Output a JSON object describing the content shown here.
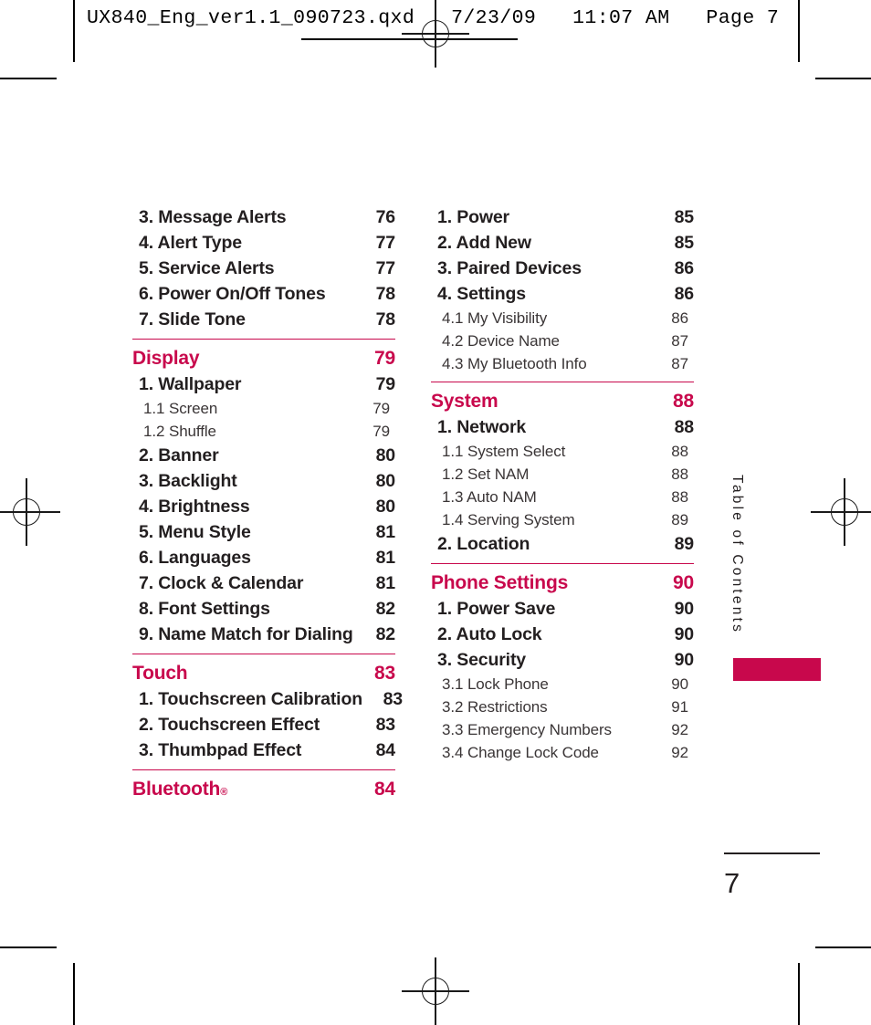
{
  "prepress": {
    "slug": "UX840_Eng_ver1.1_090723.qxd   7/23/09   11:07 AM   Page 7"
  },
  "side_running_head": "Table of Contents",
  "folio": "7",
  "colors": {
    "accent": "#c8084c",
    "text": "#231f20",
    "subtext": "#3a3536"
  },
  "toc": {
    "left_column": [
      {
        "type": "item1",
        "label": "3. Message Alerts",
        "page": "76"
      },
      {
        "type": "item1",
        "label": "4. Alert Type",
        "page": "77"
      },
      {
        "type": "item1",
        "label": "5. Service Alerts",
        "page": "77"
      },
      {
        "type": "item1",
        "label": "6. Power On/Off Tones",
        "page": "78"
      },
      {
        "type": "item1",
        "label": "7. Slide Tone",
        "page": "78"
      },
      {
        "type": "section",
        "label": "Display",
        "page": "79"
      },
      {
        "type": "item1",
        "label": "1. Wallpaper",
        "page": "79"
      },
      {
        "type": "item2",
        "label": "1.1 Screen",
        "page": "79"
      },
      {
        "type": "item2",
        "label": "1.2 Shuffle",
        "page": "79"
      },
      {
        "type": "item1",
        "label": "2. Banner",
        "page": "80"
      },
      {
        "type": "item1",
        "label": "3. Backlight",
        "page": "80"
      },
      {
        "type": "item1",
        "label": "4. Brightness",
        "page": "80"
      },
      {
        "type": "item1",
        "label": "5. Menu Style",
        "page": "81"
      },
      {
        "type": "item1",
        "label": "6. Languages",
        "page": "81"
      },
      {
        "type": "item1",
        "label": "7. Clock & Calendar",
        "page": "81"
      },
      {
        "type": "item1",
        "label": "8. Font Settings",
        "page": "82"
      },
      {
        "type": "item1",
        "label": "9.  Name Match for Dialing",
        "page": "82"
      },
      {
        "type": "section",
        "label": "Touch",
        "page": "83"
      },
      {
        "type": "item1",
        "label": "1. Touchscreen Calibration",
        "page": "83"
      },
      {
        "type": "item1",
        "label": "2. Touchscreen Effect",
        "page": "83"
      },
      {
        "type": "item1",
        "label": "3. Thumbpad Effect",
        "page": "84"
      },
      {
        "type": "section",
        "label": "Bluetooth",
        "label_sup": "®",
        "page": "84"
      }
    ],
    "right_column": [
      {
        "type": "item1",
        "label": "1. Power",
        "page": "85"
      },
      {
        "type": "item1",
        "label": "2. Add New",
        "page": "85"
      },
      {
        "type": "item1",
        "label": "3. Paired Devices",
        "page": "86"
      },
      {
        "type": "item1",
        "label": "4. Settings",
        "page": "86"
      },
      {
        "type": "item2",
        "label": "4.1 My Visibility",
        "page": "86"
      },
      {
        "type": "item2",
        "label": "4.2 Device Name",
        "page": "87"
      },
      {
        "type": "item2",
        "label": "4.3 My Bluetooth Info",
        "page": "87"
      },
      {
        "type": "section",
        "label": "System",
        "page": "88"
      },
      {
        "type": "item1",
        "label": "1. Network",
        "page": "88"
      },
      {
        "type": "item2",
        "label": "1.1 System Select",
        "page": "88"
      },
      {
        "type": "item2",
        "label": "1.2 Set NAM",
        "page": "88"
      },
      {
        "type": "item2",
        "label": "1.3 Auto NAM",
        "page": "88"
      },
      {
        "type": "item2",
        "label": "1.4 Serving System",
        "page": "89"
      },
      {
        "type": "item1",
        "label": "2. Location",
        "page": "89"
      },
      {
        "type": "section",
        "label": "Phone Settings",
        "page": "90"
      },
      {
        "type": "item1",
        "label": "1. Power Save",
        "page": "90"
      },
      {
        "type": "item1",
        "label": "2. Auto Lock",
        "page": "90"
      },
      {
        "type": "item1",
        "label": "3. Security",
        "page": "90"
      },
      {
        "type": "item2",
        "label": "3.1 Lock Phone",
        "page": "90"
      },
      {
        "type": "item2",
        "label": "3.2 Restrictions",
        "page": "91"
      },
      {
        "type": "item2",
        "label": "3.3 Emergency Numbers",
        "page": "92"
      },
      {
        "type": "item2",
        "label": "3.4 Change Lock Code",
        "page": "92"
      }
    ]
  }
}
